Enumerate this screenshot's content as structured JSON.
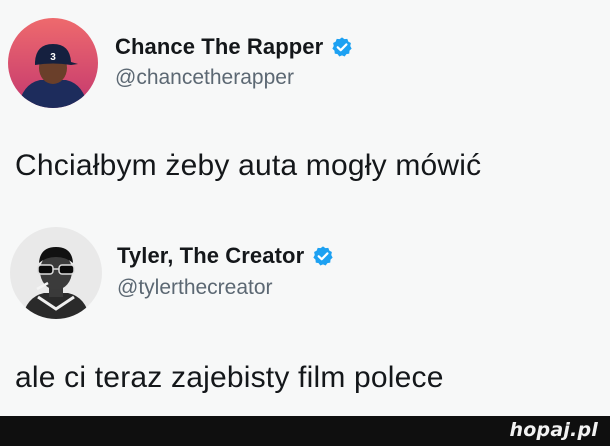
{
  "tweets": [
    {
      "display_name": "Chance The Rapper",
      "handle": "@chancetherapper",
      "text": "Chciałbym żeby auta mogły mówić",
      "verified_icon": "verified-badge-icon",
      "avatar_badge": "3"
    },
    {
      "display_name": "Tyler, The Creator",
      "handle": "@tylerthecreator",
      "text": "ale ci teraz zajebisty film polece",
      "verified_icon": "verified-badge-icon"
    }
  ],
  "footer": {
    "watermark": "hopaj.pl"
  },
  "colors": {
    "background": "#f7f8f8",
    "verified_blue": "#1da1f2",
    "handle_gray": "#5c6873",
    "footer_bar": "#0f0f0f"
  }
}
